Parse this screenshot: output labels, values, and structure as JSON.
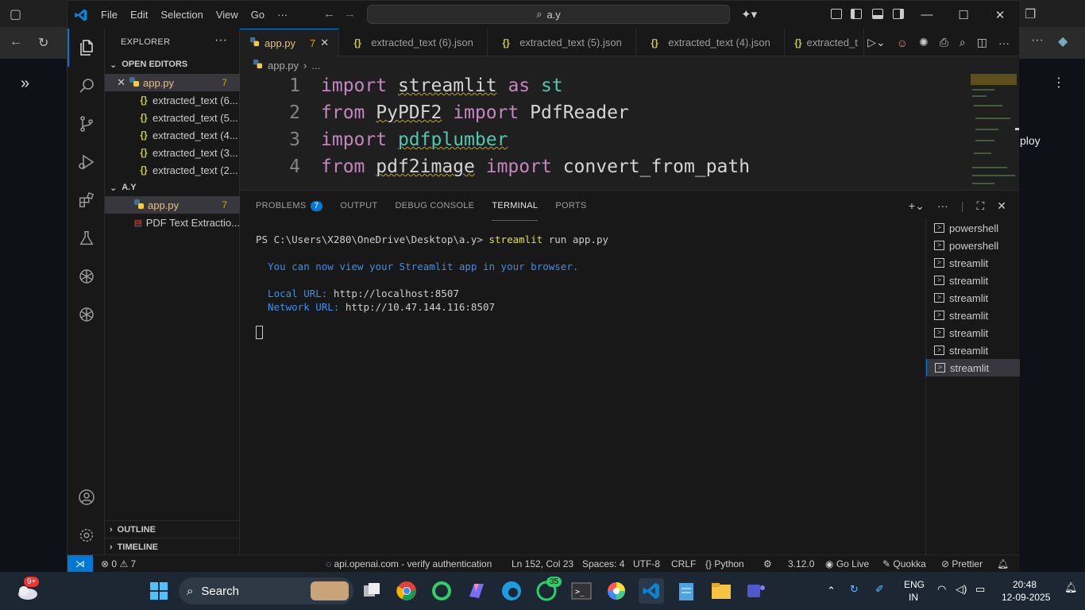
{
  "browser": {
    "deploy_text": "ploy"
  },
  "vscode": {
    "menu": [
      "File",
      "Edit",
      "Selection",
      "View",
      "Go",
      "···"
    ],
    "command_center": "a.y",
    "explorer": {
      "title": "EXPLORER",
      "open_editors_label": "OPEN EDITORS",
      "open_editors": [
        {
          "name": "app.py",
          "badge": "7"
        },
        {
          "name": "extracted_text (6..."
        },
        {
          "name": "extracted_text (5..."
        },
        {
          "name": "extracted_text (4..."
        },
        {
          "name": "extracted_text (3..."
        },
        {
          "name": "extracted_text (2..."
        }
      ],
      "folder_label": "A.Y",
      "files": [
        {
          "name": "app.py",
          "badge": "7"
        },
        {
          "name": "PDF Text Extractio..."
        }
      ],
      "outline_label": "OUTLINE",
      "timeline_label": "TIMELINE"
    },
    "tabs": [
      {
        "name": "app.py",
        "badge": "7"
      },
      {
        "name": "extracted_text (6).json"
      },
      {
        "name": "extracted_text (5).json"
      },
      {
        "name": "extracted_text (4).json"
      },
      {
        "name": "extracted_t"
      }
    ],
    "breadcrumb": [
      "app.py",
      "..."
    ],
    "code_lines": [
      {
        "num": "1",
        "parts": [
          [
            "kw",
            "import"
          ],
          [
            "sp",
            " "
          ],
          [
            "mod squig",
            "streamlit"
          ],
          [
            "sp",
            " "
          ],
          [
            "kw",
            "as"
          ],
          [
            "sp",
            " "
          ],
          [
            "mod2",
            "st"
          ]
        ]
      },
      {
        "num": "2",
        "parts": [
          [
            "kw",
            "from"
          ],
          [
            "sp",
            " "
          ],
          [
            "mod squig",
            "PyPDF2"
          ],
          [
            "sp",
            " "
          ],
          [
            "kw",
            "import"
          ],
          [
            "sp",
            " "
          ],
          [
            "mod",
            "PdfReader"
          ]
        ]
      },
      {
        "num": "3",
        "parts": [
          [
            "kw",
            "import"
          ],
          [
            "sp",
            " "
          ],
          [
            "mod2 squig",
            "pdfplumber"
          ]
        ]
      },
      {
        "num": "4",
        "parts": [
          [
            "kw",
            "from"
          ],
          [
            "sp",
            " "
          ],
          [
            "mod squig",
            "pdf2image"
          ],
          [
            "sp",
            " "
          ],
          [
            "kw",
            "import"
          ],
          [
            "sp",
            " "
          ],
          [
            "mod",
            "convert_from_path"
          ]
        ]
      }
    ],
    "panel": {
      "tabs": [
        "PROBLEMS",
        "OUTPUT",
        "DEBUG CONSOLE",
        "TERMINAL",
        "PORTS"
      ],
      "problems_count": "7",
      "terminal": {
        "prompt": "PS C:\\Users\\X280\\OneDrive\\Desktop\\a.y> ",
        "cmd": "streamlit",
        "cmd_args": " run app.py",
        "line1": "  You can now view your Streamlit app in your browser.",
        "local_label": "  Local URL: ",
        "local_url": "http://localhost:8507",
        "network_label": "  Network URL: ",
        "network_url": "http://10.47.144.116:8507"
      },
      "terminals": [
        "powershell",
        "powershell",
        "streamlit",
        "streamlit",
        "streamlit",
        "streamlit",
        "streamlit",
        "streamlit",
        "streamlit"
      ]
    },
    "status": {
      "errors": "0",
      "warnings": "7",
      "auth": "api.openai.com - verify authentication",
      "position": "Ln 152, Col 23",
      "spaces": "Spaces: 4",
      "encoding": "UTF-8",
      "eol": "CRLF",
      "language": "Python",
      "python_version": "3.12.0",
      "golive": "Go Live",
      "quokka": "Quokka",
      "prettier": "Prettier"
    }
  },
  "taskbar": {
    "search": "Search",
    "whatsapp_badge": "35",
    "weather_badge": "9+",
    "lang1": "ENG",
    "lang2": "IN",
    "time": "20:48",
    "date": "12-09-2025"
  },
  "colors": {
    "accent": "#0078d4",
    "keyword": "#c586c0",
    "terminal_blue": "#3b8eea"
  }
}
